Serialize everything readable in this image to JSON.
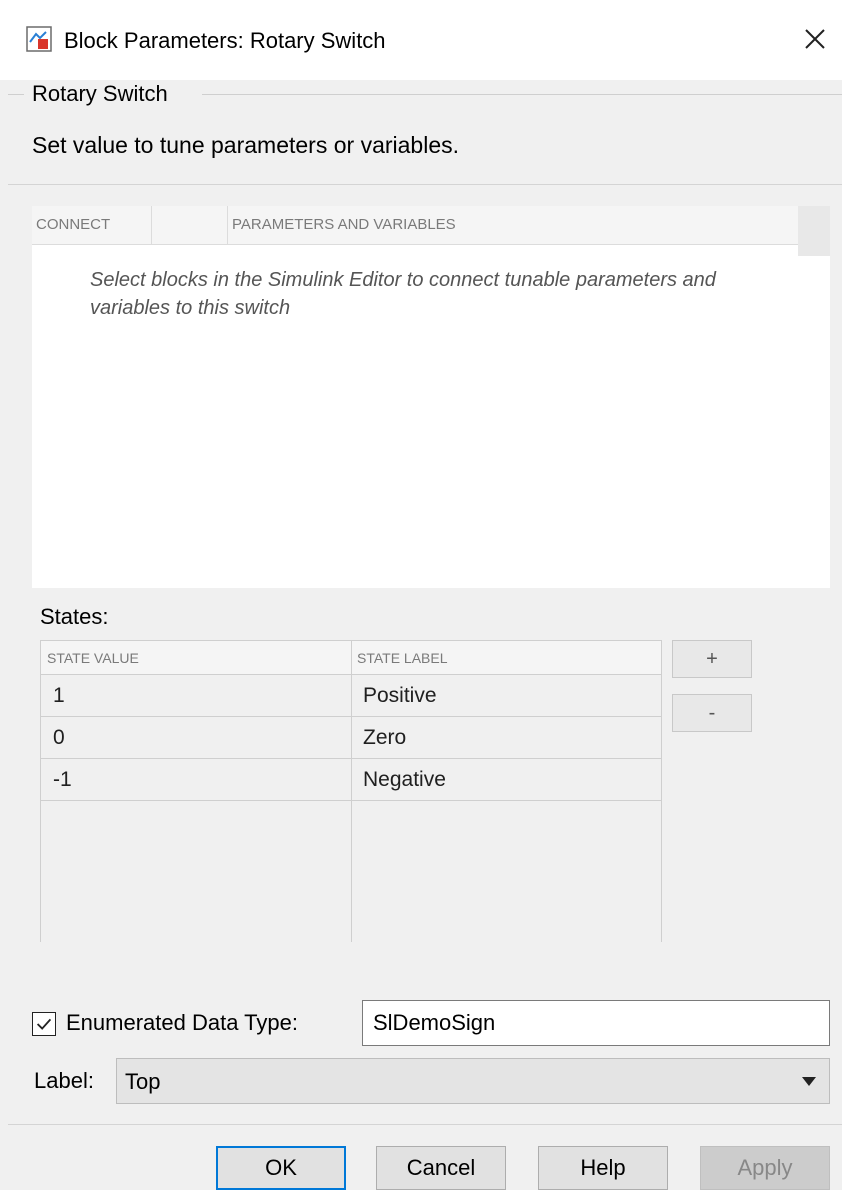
{
  "window": {
    "title": "Block Parameters: Rotary Switch",
    "close_symbol": "✕"
  },
  "group": {
    "title": "Rotary Switch",
    "description": "Set value to tune parameters or variables."
  },
  "connect_table": {
    "columns": [
      "CONNECT",
      "",
      "PARAMETERS AND VARIABLES"
    ],
    "empty_message": "Select blocks in the Simulink Editor to connect tunable parameters and variables to this switch"
  },
  "states": {
    "label": "States:",
    "columns": [
      "STATE VALUE",
      "STATE LABEL"
    ],
    "rows": [
      {
        "value": "1",
        "label": "Positive"
      },
      {
        "value": "0",
        "label": "Zero"
      },
      {
        "value": "-1",
        "label": "Negative"
      }
    ],
    "add_label": "+",
    "remove_label": "-"
  },
  "enumerated": {
    "label": "Enumerated Data Type:",
    "checked": true,
    "value": "SlDemoSign"
  },
  "label_field": {
    "label": "Label:",
    "value": "Top"
  },
  "buttons": {
    "ok": "OK",
    "cancel": "Cancel",
    "help": "Help",
    "apply": "Apply"
  },
  "colors": {
    "accent": "#0078d7",
    "icon_blue": "#2a7fd4",
    "icon_red": "#d9362b"
  }
}
